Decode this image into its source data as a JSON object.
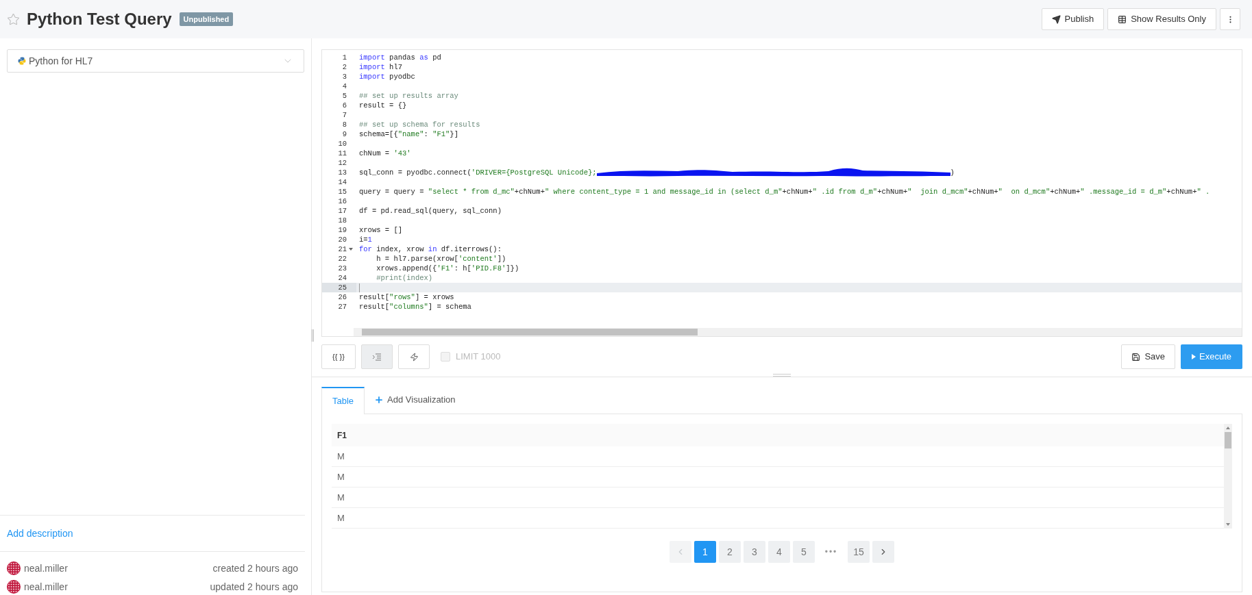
{
  "header": {
    "starred": false,
    "title": "Python Test Query",
    "status_badge": "Unpublished",
    "actions": [
      {
        "kind": "publish",
        "label": "Publish"
      },
      {
        "kind": "table",
        "label": "Show Results Only"
      },
      {
        "kind": "more"
      }
    ]
  },
  "sidebar": {
    "data_source": "Python for HL7",
    "add_description": "Add description",
    "history": [
      {
        "user": "neal.miller",
        "event": "created 2 hours ago"
      },
      {
        "user": "neal.miller",
        "event": "updated 2 hours ago"
      }
    ]
  },
  "editor": {
    "lines": [
      {
        "n": "1",
        "active": false,
        "foldable": false,
        "tokens": [
          {
            "kind": "kw",
            "text": "import"
          },
          {
            "kind": "p",
            "text": " pandas "
          },
          {
            "kind": "kw",
            "text": "as"
          },
          {
            "kind": "p",
            "text": " pd"
          }
        ]
      },
      {
        "n": "2",
        "active": false,
        "foldable": false,
        "tokens": [
          {
            "kind": "kw",
            "text": "import"
          },
          {
            "kind": "p",
            "text": " hl7"
          }
        ]
      },
      {
        "n": "3",
        "active": false,
        "foldable": false,
        "tokens": [
          {
            "kind": "kw",
            "text": "import"
          },
          {
            "kind": "p",
            "text": " pyodbc"
          }
        ]
      },
      {
        "n": "4",
        "active": false,
        "foldable": false
      },
      {
        "n": "5",
        "active": false,
        "foldable": false,
        "tokens": [
          {
            "kind": "cmt",
            "text": "## set up results array"
          }
        ]
      },
      {
        "n": "6",
        "active": false,
        "foldable": false,
        "tokens": [
          {
            "kind": "p",
            "text": "result = {}"
          }
        ]
      },
      {
        "n": "7",
        "active": false,
        "foldable": false
      },
      {
        "n": "8",
        "active": false,
        "foldable": false,
        "tokens": [
          {
            "kind": "cmt",
            "text": "## set up schema for results"
          }
        ]
      },
      {
        "n": "9",
        "active": false,
        "foldable": false,
        "tokens": [
          {
            "kind": "p",
            "text": "schema=[{"
          },
          {
            "kind": "str",
            "text": "\"name\""
          },
          {
            "kind": "p",
            "text": ": "
          },
          {
            "kind": "str",
            "text": "\"F1\""
          },
          {
            "kind": "p",
            "text": "}]"
          }
        ]
      },
      {
        "n": "10",
        "active": false,
        "foldable": false
      },
      {
        "n": "11",
        "active": false,
        "foldable": false,
        "tokens": [
          {
            "kind": "p",
            "text": "chNum = "
          },
          {
            "kind": "str",
            "text": "'43'"
          }
        ]
      },
      {
        "n": "12",
        "active": false,
        "foldable": false
      },
      {
        "n": "13",
        "active": false,
        "foldable": false,
        "tokens": [
          {
            "kind": "p",
            "text": "sql_conn = pyodbc.connect("
          },
          {
            "kind": "str",
            "text": "'DRIVER={PostgreSQL Unicode};"
          },
          {
            "kind": "redacted"
          },
          {
            "kind": "p",
            "text": ")"
          }
        ]
      },
      {
        "n": "14",
        "active": false,
        "foldable": false
      },
      {
        "n": "15",
        "active": false,
        "foldable": false,
        "tokens": [
          {
            "kind": "p",
            "text": "query = query = "
          },
          {
            "kind": "str",
            "text": "\"select * from d_mc\""
          },
          {
            "kind": "p",
            "text": "+chNum+"
          },
          {
            "kind": "str",
            "text": "\" where content_type = 1 and message_id in (select d_m\""
          },
          {
            "kind": "p",
            "text": "+chNum+"
          },
          {
            "kind": "str",
            "text": "\" .id from d_m\""
          },
          {
            "kind": "p",
            "text": "+chNum+"
          },
          {
            "kind": "str",
            "text": "\"  join d_mcm\""
          },
          {
            "kind": "p",
            "text": "+chNum+"
          },
          {
            "kind": "str",
            "text": "\"  on d_mcm\""
          },
          {
            "kind": "p",
            "text": "+chNum+"
          },
          {
            "kind": "str",
            "text": "\" .message_id = d_m\""
          },
          {
            "kind": "p",
            "text": "+chNum+"
          },
          {
            "kind": "str",
            "text": "\" ."
          }
        ]
      },
      {
        "n": "16",
        "active": false,
        "foldable": false
      },
      {
        "n": "17",
        "active": false,
        "foldable": false,
        "tokens": [
          {
            "kind": "p",
            "text": "df = pd.read_sql(query, sql_conn)"
          }
        ]
      },
      {
        "n": "18",
        "active": false,
        "foldable": false
      },
      {
        "n": "19",
        "active": false,
        "foldable": false,
        "tokens": [
          {
            "kind": "p",
            "text": "xrows = []"
          }
        ]
      },
      {
        "n": "20",
        "active": false,
        "foldable": false,
        "tokens": [
          {
            "kind": "p",
            "text": "i="
          },
          {
            "kind": "num",
            "text": "1"
          }
        ]
      },
      {
        "n": "21",
        "active": false,
        "foldable": true,
        "tokens": [
          {
            "kind": "kw",
            "text": "for"
          },
          {
            "kind": "p",
            "text": " index, xrow "
          },
          {
            "kind": "kw",
            "text": "in"
          },
          {
            "kind": "p",
            "text": " df.iterrows():"
          }
        ]
      },
      {
        "n": "22",
        "active": false,
        "foldable": false,
        "tokens": [
          {
            "kind": "p",
            "text": "    h = hl7.parse(xrow["
          },
          {
            "kind": "str",
            "text": "'content'"
          },
          {
            "kind": "p",
            "text": "])"
          }
        ]
      },
      {
        "n": "23",
        "active": false,
        "foldable": false,
        "tokens": [
          {
            "kind": "p",
            "text": "    xrows.append({"
          },
          {
            "kind": "str",
            "text": "'F1'"
          },
          {
            "kind": "p",
            "text": ": h["
          },
          {
            "kind": "str",
            "text": "'PID.F8'"
          },
          {
            "kind": "p",
            "text": "]})"
          }
        ]
      },
      {
        "n": "24",
        "active": false,
        "foldable": false,
        "tokens": [
          {
            "kind": "cmt",
            "text": "    #print(index)"
          }
        ]
      },
      {
        "n": "25",
        "active": true,
        "foldable": false
      },
      {
        "n": "26",
        "active": false,
        "foldable": false,
        "tokens": [
          {
            "kind": "p",
            "text": "result["
          },
          {
            "kind": "str",
            "text": "\"rows\""
          },
          {
            "kind": "p",
            "text": "] = xrows"
          }
        ]
      },
      {
        "n": "27",
        "active": false,
        "foldable": false,
        "tokens": [
          {
            "kind": "p",
            "text": "result["
          },
          {
            "kind": "str",
            "text": "\"columns\""
          },
          {
            "kind": "p",
            "text": "] = schema"
          }
        ]
      }
    ]
  },
  "toolbar": {
    "tools": [
      {
        "kind": "params",
        "label": "{{ }}",
        "active": false
      },
      {
        "kind": "format",
        "active": true
      },
      {
        "kind": "autocomplete",
        "active": false
      }
    ],
    "limit": {
      "label": "LIMIT 1000",
      "checked": false,
      "disabled": true
    },
    "save": "Save",
    "execute": "Execute"
  },
  "results": {
    "tabs": [
      {
        "kind": "tab",
        "label": "Table",
        "selected": true
      },
      {
        "kind": "add",
        "label": "Add Visualization",
        "selected": false
      }
    ],
    "table": {
      "columns": [
        "F1"
      ],
      "rows": [
        [
          "M"
        ],
        [
          "M"
        ],
        [
          "M"
        ],
        [
          "M"
        ]
      ]
    },
    "pagination": [
      {
        "kind": "prev",
        "disabled": true
      },
      {
        "kind": "page",
        "label": "1",
        "selected": true
      },
      {
        "kind": "page",
        "label": "2",
        "selected": false
      },
      {
        "kind": "page",
        "label": "3",
        "selected": false
      },
      {
        "kind": "page",
        "label": "4",
        "selected": false
      },
      {
        "kind": "page",
        "label": "5",
        "selected": false
      },
      {
        "kind": "ellipsis",
        "label": "•••"
      },
      {
        "kind": "page",
        "label": "15",
        "selected": false
      },
      {
        "kind": "next",
        "disabled": false
      }
    ]
  }
}
